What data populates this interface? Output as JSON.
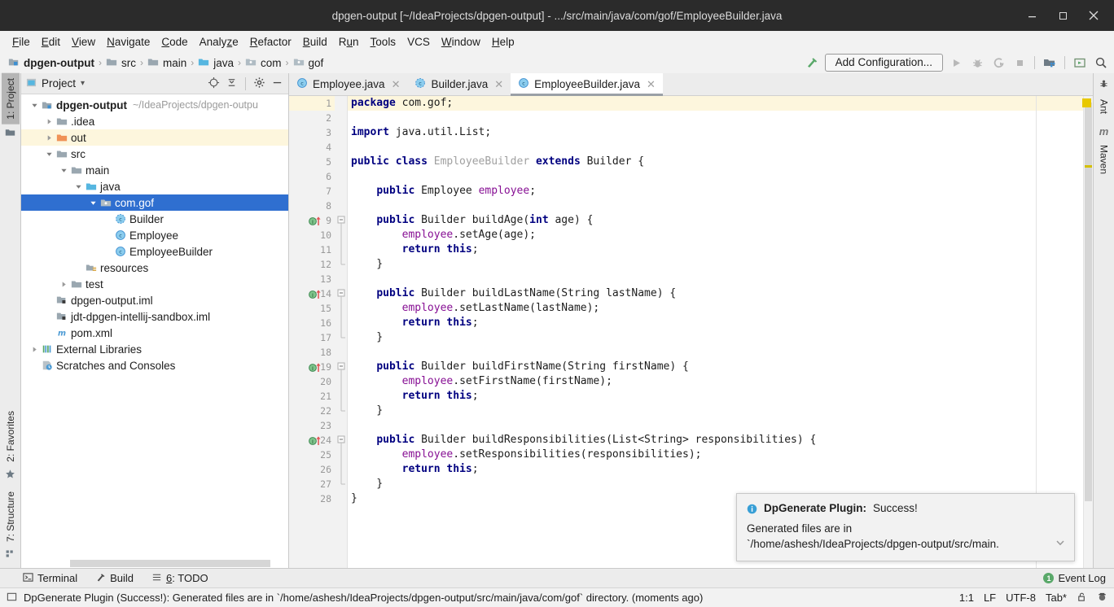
{
  "window": {
    "title": "dpgen-output [~/IdeaProjects/dpgen-output] - .../src/main/java/com/gof/EmployeeBuilder.java",
    "minimize": "—",
    "maximize": "□",
    "close": "✕"
  },
  "menubar": {
    "items": [
      "File",
      "Edit",
      "View",
      "Navigate",
      "Code",
      "Analyze",
      "Refactor",
      "Build",
      "Run",
      "Tools",
      "VCS",
      "Window",
      "Help"
    ]
  },
  "navbar": {
    "crumbs": [
      {
        "label": "dpgen-output",
        "icon": "module-icon",
        "bold": true
      },
      {
        "label": "src",
        "icon": "folder-icon",
        "bold": false
      },
      {
        "label": "main",
        "icon": "folder-icon",
        "bold": false
      },
      {
        "label": "java",
        "icon": "source-folder-icon",
        "bold": false
      },
      {
        "label": "com",
        "icon": "package-icon",
        "bold": false
      },
      {
        "label": "gof",
        "icon": "package-icon",
        "bold": false
      }
    ],
    "separator": "›",
    "add_configuration": "Add Configuration...",
    "icons": [
      "build-hammer-icon",
      "run-icon",
      "debug-icon",
      "run-coverage-icon",
      "stop-icon",
      "project-structure-icon",
      "run-anything-icon",
      "search-everywhere-icon"
    ]
  },
  "left_strip": {
    "top": [
      {
        "label": "1: Project",
        "icon": "project-icon",
        "active": true
      }
    ],
    "bottom": [
      {
        "label": "2: Favorites",
        "icon": "star-icon"
      },
      {
        "label": "7: Structure",
        "icon": "structure-icon"
      }
    ]
  },
  "right_strip": {
    "items": [
      {
        "label": "Ant",
        "icon": "ant-icon"
      },
      {
        "label": "Maven",
        "icon": "maven-icon"
      }
    ]
  },
  "project_panel": {
    "title": "Project",
    "dropdown_caret": "▾",
    "icons": [
      "locate-icon",
      "collapse-all-icon",
      "settings-gear-icon",
      "hide-icon"
    ],
    "tree": [
      {
        "depth": 0,
        "arrow": "down",
        "icon": "module-icon",
        "label": "dpgen-output",
        "sub": "~/IdeaProjects/dpgen-outpu",
        "bold": true
      },
      {
        "depth": 1,
        "arrow": "right",
        "icon": "folder-icon",
        "label": ".idea"
      },
      {
        "depth": 1,
        "arrow": "right",
        "icon": "folder-orange-icon",
        "label": "out",
        "highlight": true
      },
      {
        "depth": 1,
        "arrow": "down",
        "icon": "folder-icon",
        "label": "src"
      },
      {
        "depth": 2,
        "arrow": "down",
        "icon": "folder-icon",
        "label": "main"
      },
      {
        "depth": 3,
        "arrow": "down",
        "icon": "source-folder-icon",
        "label": "java"
      },
      {
        "depth": 4,
        "arrow": "down",
        "icon": "package-icon",
        "label": "com.gof",
        "selected": true
      },
      {
        "depth": 5,
        "arrow": "none",
        "icon": "interface-icon",
        "label": "Builder"
      },
      {
        "depth": 5,
        "arrow": "none",
        "icon": "class-icon",
        "label": "Employee"
      },
      {
        "depth": 5,
        "arrow": "none",
        "icon": "class-icon",
        "label": "EmployeeBuilder"
      },
      {
        "depth": 3,
        "arrow": "none",
        "icon": "resources-folder-icon",
        "label": "resources"
      },
      {
        "depth": 2,
        "arrow": "right",
        "icon": "folder-icon",
        "label": "test"
      },
      {
        "depth": 1,
        "arrow": "none",
        "icon": "iml-icon",
        "label": "dpgen-output.iml"
      },
      {
        "depth": 1,
        "arrow": "none",
        "icon": "iml-icon",
        "label": "jdt-dpgen-intellij-sandbox.iml"
      },
      {
        "depth": 1,
        "arrow": "none",
        "icon": "maven-pom-icon",
        "label": "pom.xml"
      },
      {
        "depth": 0,
        "arrow": "right",
        "icon": "libraries-icon",
        "label": "External Libraries"
      },
      {
        "depth": 0,
        "arrow": "none",
        "icon": "scratches-icon",
        "label": "Scratches and Consoles"
      }
    ]
  },
  "editor": {
    "tabs": [
      {
        "label": "Employee.java",
        "icon": "class-icon",
        "active": false,
        "close": "✕"
      },
      {
        "label": "Builder.java",
        "icon": "interface-icon",
        "active": false,
        "close": "✕"
      },
      {
        "label": "EmployeeBuilder.java",
        "icon": "class-icon",
        "active": true,
        "close": "✕"
      }
    ],
    "lines": [
      {
        "n": 1,
        "highlight": true,
        "tokens": [
          {
            "t": "package",
            "c": "k"
          },
          {
            "t": " com.gof;",
            "c": "pl"
          }
        ]
      },
      {
        "n": 2,
        "tokens": []
      },
      {
        "n": 3,
        "tokens": [
          {
            "t": "import",
            "c": "k"
          },
          {
            "t": " java.util.List;",
            "c": "pl"
          }
        ]
      },
      {
        "n": 4,
        "tokens": []
      },
      {
        "n": 5,
        "tokens": [
          {
            "t": "public class",
            "c": "k"
          },
          {
            "t": " ",
            "c": "pl"
          },
          {
            "t": "EmployeeBuilder",
            "c": "cl"
          },
          {
            "t": " ",
            "c": "pl"
          },
          {
            "t": "extends",
            "c": "k"
          },
          {
            "t": " Builder {",
            "c": "pl"
          }
        ]
      },
      {
        "n": 6,
        "tokens": []
      },
      {
        "n": 7,
        "tokens": [
          {
            "t": "    ",
            "c": "pl"
          },
          {
            "t": "public",
            "c": "k"
          },
          {
            "t": " Employee ",
            "c": "pl"
          },
          {
            "t": "employee",
            "c": "fd"
          },
          {
            "t": ";",
            "c": "pl"
          }
        ]
      },
      {
        "n": 8,
        "tokens": []
      },
      {
        "n": 9,
        "gutter": "override",
        "fold": "start",
        "tokens": [
          {
            "t": "    ",
            "c": "pl"
          },
          {
            "t": "public",
            "c": "k"
          },
          {
            "t": " Builder buildAge(",
            "c": "pl"
          },
          {
            "t": "int",
            "c": "k"
          },
          {
            "t": " age) {",
            "c": "pl"
          }
        ]
      },
      {
        "n": 10,
        "tokens": [
          {
            "t": "        ",
            "c": "pl"
          },
          {
            "t": "employee",
            "c": "fd"
          },
          {
            "t": ".setAge(age);",
            "c": "pl"
          }
        ]
      },
      {
        "n": 11,
        "tokens": [
          {
            "t": "        ",
            "c": "pl"
          },
          {
            "t": "return this",
            "c": "k"
          },
          {
            "t": ";",
            "c": "pl"
          }
        ]
      },
      {
        "n": 12,
        "fold": "end",
        "tokens": [
          {
            "t": "    }",
            "c": "pl"
          }
        ]
      },
      {
        "n": 13,
        "tokens": []
      },
      {
        "n": 14,
        "gutter": "override",
        "fold": "start",
        "tokens": [
          {
            "t": "    ",
            "c": "pl"
          },
          {
            "t": "public",
            "c": "k"
          },
          {
            "t": " Builder buildLastName(String lastName) {",
            "c": "pl"
          }
        ]
      },
      {
        "n": 15,
        "tokens": [
          {
            "t": "        ",
            "c": "pl"
          },
          {
            "t": "employee",
            "c": "fd"
          },
          {
            "t": ".setLastName(lastName);",
            "c": "pl"
          }
        ]
      },
      {
        "n": 16,
        "tokens": [
          {
            "t": "        ",
            "c": "pl"
          },
          {
            "t": "return this",
            "c": "k"
          },
          {
            "t": ";",
            "c": "pl"
          }
        ]
      },
      {
        "n": 17,
        "fold": "end",
        "tokens": [
          {
            "t": "    }",
            "c": "pl"
          }
        ]
      },
      {
        "n": 18,
        "tokens": []
      },
      {
        "n": 19,
        "gutter": "override",
        "fold": "start",
        "tokens": [
          {
            "t": "    ",
            "c": "pl"
          },
          {
            "t": "public",
            "c": "k"
          },
          {
            "t": " Builder buildFirstName(String firstName) {",
            "c": "pl"
          }
        ]
      },
      {
        "n": 20,
        "tokens": [
          {
            "t": "        ",
            "c": "pl"
          },
          {
            "t": "employee",
            "c": "fd"
          },
          {
            "t": ".setFirstName(firstName);",
            "c": "pl"
          }
        ]
      },
      {
        "n": 21,
        "tokens": [
          {
            "t": "        ",
            "c": "pl"
          },
          {
            "t": "return this",
            "c": "k"
          },
          {
            "t": ";",
            "c": "pl"
          }
        ]
      },
      {
        "n": 22,
        "fold": "end",
        "tokens": [
          {
            "t": "    }",
            "c": "pl"
          }
        ]
      },
      {
        "n": 23,
        "tokens": []
      },
      {
        "n": 24,
        "gutter": "override",
        "fold": "start",
        "tokens": [
          {
            "t": "    ",
            "c": "pl"
          },
          {
            "t": "public",
            "c": "k"
          },
          {
            "t": " Builder buildResponsibilities(List<String> responsibilities) {",
            "c": "pl"
          }
        ]
      },
      {
        "n": 25,
        "tokens": [
          {
            "t": "        ",
            "c": "pl"
          },
          {
            "t": "employee",
            "c": "fd"
          },
          {
            "t": ".setResponsibilities(responsibilities);",
            "c": "pl"
          }
        ]
      },
      {
        "n": 26,
        "tokens": [
          {
            "t": "        ",
            "c": "pl"
          },
          {
            "t": "return this",
            "c": "k"
          },
          {
            "t": ";",
            "c": "pl"
          }
        ]
      },
      {
        "n": 27,
        "fold": "end",
        "tokens": [
          {
            "t": "    }",
            "c": "pl"
          }
        ]
      },
      {
        "n": 28,
        "tokens": [
          {
            "t": "}",
            "c": "pl"
          }
        ]
      }
    ]
  },
  "notification": {
    "icon": "info-icon",
    "title": "DpGenerate Plugin:",
    "status": "Success!",
    "body_line1": "Generated files are in",
    "body_line2": "`/home/ashesh/IdeaProjects/dpgen-output/src/main.",
    "chevron": "⌄"
  },
  "bottom_toolbar": {
    "items": [
      {
        "label": "Terminal",
        "icon": "terminal-icon"
      },
      {
        "label": "Build",
        "icon": "build-hammer-icon"
      },
      {
        "label": "6: TODO",
        "icon": "todo-icon",
        "mnemonic": "6"
      }
    ],
    "event_log": {
      "label": "Event Log",
      "count": "1"
    }
  },
  "statusbar": {
    "icon": "status-message-icon",
    "message": "DpGenerate Plugin (Success!): Generated files are in `/home/ashesh/IdeaProjects/dpgen-output/src/main/java/com/gof` directory. (moments ago)",
    "caret": "1:1",
    "line_sep": "LF",
    "encoding": "UTF-8",
    "indent": "Tab*",
    "lock_icon": "unlocked-icon",
    "inspector_icon": "inspector-icon"
  },
  "colors": {
    "title_bg": "#2b2b2b",
    "chrome_bg": "#f2f2f2",
    "selection_blue": "#2f6fd0",
    "caret_row": "#fdf6dd",
    "keyword": "#000080",
    "field": "#871094",
    "declaration_gray": "#a0a0a0",
    "success_green": "#59a869",
    "info_blue": "#389fd6",
    "marker_yellow": "#e8c800"
  }
}
